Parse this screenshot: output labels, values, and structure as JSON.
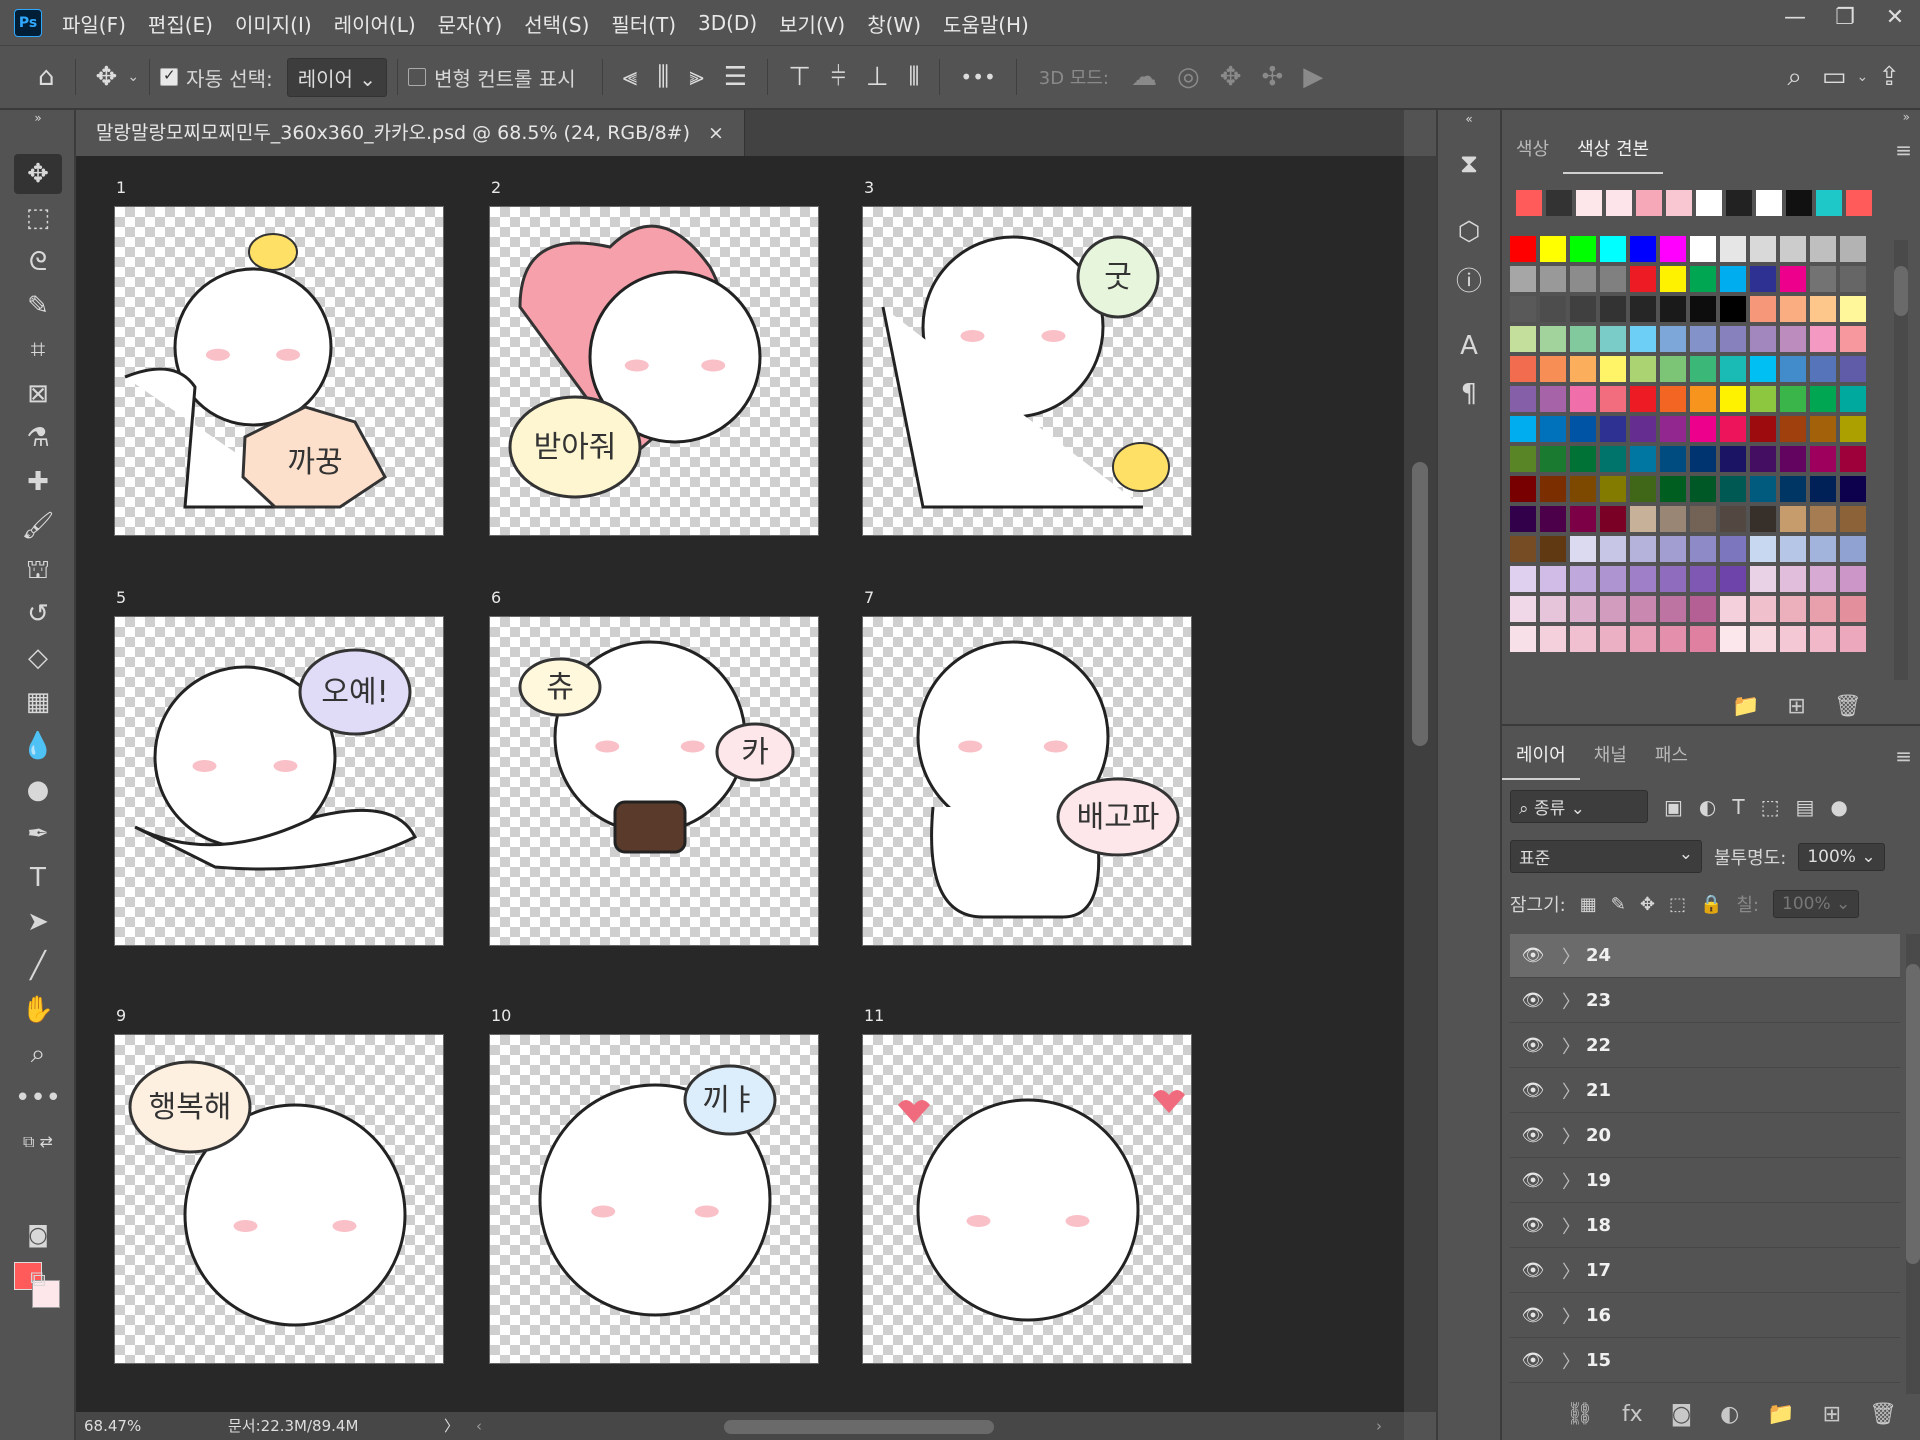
{
  "app": {
    "logo": "Ps"
  },
  "menu": [
    "파일(F)",
    "편집(E)",
    "이미지(I)",
    "레이어(L)",
    "문자(Y)",
    "선택(S)",
    "필터(T)",
    "3D(D)",
    "보기(V)",
    "창(W)",
    "도움말(H)"
  ],
  "window_controls": {
    "minimize": "—",
    "restore": "❐",
    "close": "✕"
  },
  "options": {
    "auto_select_label": "자동 선택:",
    "auto_select_value": "레이어",
    "transform_label": "변형 컨트롤 표시",
    "more": "•••",
    "mode_3d": "3D 모드:"
  },
  "document": {
    "tab_title": "말랑말랑모찌모찌민두_360x360_카카오.psd @ 68.5% (24, RGB/8#)",
    "close": "×"
  },
  "stickers": [
    {
      "num": "1",
      "text": "까꿍"
    },
    {
      "num": "2",
      "text": "받아줘"
    },
    {
      "num": "3",
      "text": "굿"
    },
    {
      "num": "5",
      "text": "오예!"
    },
    {
      "num": "6",
      "text_left": "츄",
      "text_right": "카"
    },
    {
      "num": "7",
      "text": "배고파"
    },
    {
      "num": "9",
      "text": "행복해"
    },
    {
      "num": "10",
      "text": "끼ㅑ"
    },
    {
      "num": "11",
      "text": ""
    }
  ],
  "status": {
    "zoom": "68.47%",
    "doc": "문서:22.3M/89.4M",
    "arrow": "〉"
  },
  "swatches_panel": {
    "tabs": [
      "색상",
      "색상 견본"
    ],
    "active_tab": "색상 견본",
    "recent": [
      "#ff5b5b",
      "#333333",
      "#fde7ea",
      "#fce4ea",
      "#f7a8b8",
      "#f9c7d2",
      "#ffffff",
      "#222222",
      "#ffffff",
      "#111111",
      "#1ec8c8",
      "#ff5b5b"
    ],
    "grid": [
      "#ff0000",
      "#ffff00",
      "#00ff00",
      "#00ffff",
      "#0000ff",
      "#ff00ff",
      "#ffffff",
      "#e6e6e6",
      "#d9d9d9",
      "#cccccc",
      "#bfbfbf",
      "#b3b3b3",
      "#a6a6a6",
      "#999999",
      "#8c8c8c",
      "#808080",
      "#ed1c24",
      "#fff200",
      "#00a651",
      "#00aeef",
      "#2e3192",
      "#ec008c",
      "#737373",
      "#666666",
      "#595959",
      "#4d4d4d",
      "#404040",
      "#333333",
      "#262626",
      "#1a1a1a",
      "#0d0d0d",
      "#000000",
      "#f7977a",
      "#f9ad81",
      "#fdc68a",
      "#fff79a",
      "#c4df9b",
      "#a3d39c",
      "#82ca9d",
      "#7accc8",
      "#6dcff6",
      "#7da7d9",
      "#8393ca",
      "#8781bd",
      "#a187be",
      "#bd8cbf",
      "#f49ac2",
      "#f6989d",
      "#f26c4f",
      "#f68e55",
      "#fbaf5c",
      "#fff467",
      "#acd372",
      "#7cc576",
      "#3bb878",
      "#1abbb4",
      "#00bff3",
      "#438ccb",
      "#5574b9",
      "#605ca8",
      "#855fa8",
      "#a763a8",
      "#f06ea9",
      "#f26d7d",
      "#ed1c24",
      "#f26522",
      "#f7941d",
      "#fff200",
      "#8dc63f",
      "#39b54a",
      "#00a651",
      "#00a99d",
      "#00aeef",
      "#0072bc",
      "#0054a6",
      "#2e3192",
      "#662d91",
      "#92278f",
      "#ec008c",
      "#ed145b",
      "#9e0b0f",
      "#a0410d",
      "#a36209",
      "#aba000",
      "#598527",
      "#1a7b30",
      "#007236",
      "#00746b",
      "#0076a3",
      "#004b80",
      "#003471",
      "#1b1464",
      "#440e62",
      "#630460",
      "#9e005d",
      "#9e0039",
      "#790000",
      "#7b2e00",
      "#7d4900",
      "#827b00",
      "#406618",
      "#005e20",
      "#005826",
      "#005952",
      "#005b7f",
      "#003663",
      "#002157",
      "#0d004c",
      "#32004b",
      "#4b0049",
      "#7b0046",
      "#7a0026",
      "#c7b299",
      "#998675",
      "#736357",
      "#534741",
      "#37302a",
      "#c69c6d",
      "#a67c52",
      "#8c6239",
      "#754c24",
      "#603913",
      "#dcdaf0",
      "#c8c6e6",
      "#b5b2dc",
      "#a29ed2",
      "#8e8ac8",
      "#7b76be",
      "#c8d8f0",
      "#b5c6e6",
      "#a2b4dc",
      "#8fa2d2",
      "#e0d0f0",
      "#d0bce6",
      "#bfa8dc",
      "#af94d2",
      "#9f80c8",
      "#8f6cbe",
      "#7f58b4",
      "#6f44aa",
      "#ead2e6",
      "#e0bedc",
      "#d6aad2",
      "#cc96c8",
      "#f0d8e8",
      "#e6c4da",
      "#dcb0cc",
      "#d29cbe",
      "#c888b0",
      "#be74a2",
      "#b46094",
      "#f4d0dc",
      "#f0c0cc",
      "#ecb0bc",
      "#e8a0ac",
      "#e4909c",
      "#f8e0e8",
      "#f4d0dc",
      "#f0c0d0",
      "#ecb0c4",
      "#e8a0b8",
      "#e490ac",
      "#e080a0",
      "#fce8ec",
      "#f8d8e0",
      "#f4c8d4",
      "#f0b8c8",
      "#eca8bc"
    ],
    "footer": [
      "📁",
      "⊞",
      "🗑"
    ]
  },
  "layers_panel": {
    "tabs": [
      "레이어",
      "채널",
      "패스"
    ],
    "active_tab": "레이어",
    "filter": "종류",
    "blend_mode": "표준",
    "opacity_label": "불투명도:",
    "opacity_value": "100%",
    "lock_label": "잠그기:",
    "fill_label": "칠:",
    "fill_value": "100%",
    "layers": [
      "24",
      "23",
      "22",
      "21",
      "20",
      "19",
      "18",
      "17",
      "16",
      "15"
    ],
    "selected": "24",
    "footer": [
      "⛓",
      "fx",
      "◙",
      "◐",
      "📁",
      "⊞",
      "🗑"
    ]
  }
}
